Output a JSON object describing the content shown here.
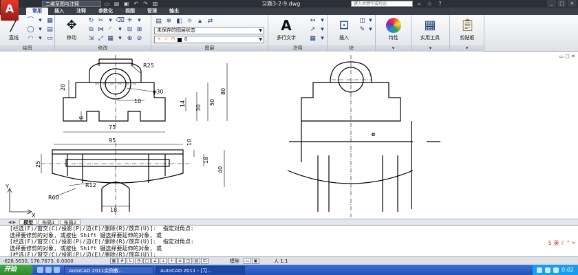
{
  "app": {
    "logo_letter": "A",
    "workspace": "二维草图与注释",
    "document_title": "习题3-2-9.dwg",
    "search_placeholder": "键入关键字或短语"
  },
  "window_buttons": [
    "_",
    "□",
    "×"
  ],
  "ribbon_tabs": [
    "常用",
    "插入",
    "注释",
    "参数化",
    "视图",
    "管理",
    "输出"
  ],
  "ribbon": {
    "draw": {
      "title": "绘图",
      "line_label": "直线"
    },
    "modify": {
      "title": "修改",
      "move_label": "移动"
    },
    "layers": {
      "title": "图层",
      "state": "未保存的图层状态",
      "current_layer": "0"
    },
    "annotation": {
      "title": "注释",
      "text_label": "多行文字"
    },
    "block": {
      "title": "块",
      "insert_label": "插入"
    },
    "properties": {
      "label": "特性"
    },
    "utilities": {
      "label": "实用工具"
    },
    "clipboard": {
      "label": "剪贴板"
    }
  },
  "dimensions": {
    "r25": "R25",
    "d30": "φ30",
    "d20": "20",
    "d10": "10",
    "d80": "80",
    "d50": "50",
    "d14": "14",
    "d30v": "30",
    "d6": "6",
    "d75": "75",
    "d95": "95",
    "d10b": "10",
    "d25": "25",
    "d18v": "18",
    "d40": "40",
    "r12": "R12",
    "r60": "R60",
    "d18": "18"
  },
  "ucs": {
    "x": "X",
    "y": "Y"
  },
  "layout_tabs": [
    "模型",
    "布局1",
    "布局2"
  ],
  "command_lines": [
    "[栏选(F)/窗交(C)/投影(P)/边(E)/删除(R)/放弃(U)]:  指定对角点:",
    "选择要修剪的对象, 或按住 Shift 键选择要延伸的对象, 或",
    "[栏选(F)/窗交(C)/投影(P)/边(E)/删除(R)/放弃(U)]:  指定对角点:",
    "选择要修剪的对象, 或按住 Shift 键选择要延伸的对象, 或",
    "[栏选(F)/窗交(C)/投影(P)/边(E)/删除(R)/放弃(U)]:"
  ],
  "ime": {
    "lang": "英"
  },
  "status": {
    "coordinates": "-628.5630, 176.7673, 0.0000",
    "model": "模型",
    "scale": "人 1:1"
  },
  "taskbar": {
    "start": "开始",
    "items": [
      "AutoCAD 2011实例教...",
      "AutoCAD 2011 - [习..."
    ],
    "clock": "0:02"
  }
}
